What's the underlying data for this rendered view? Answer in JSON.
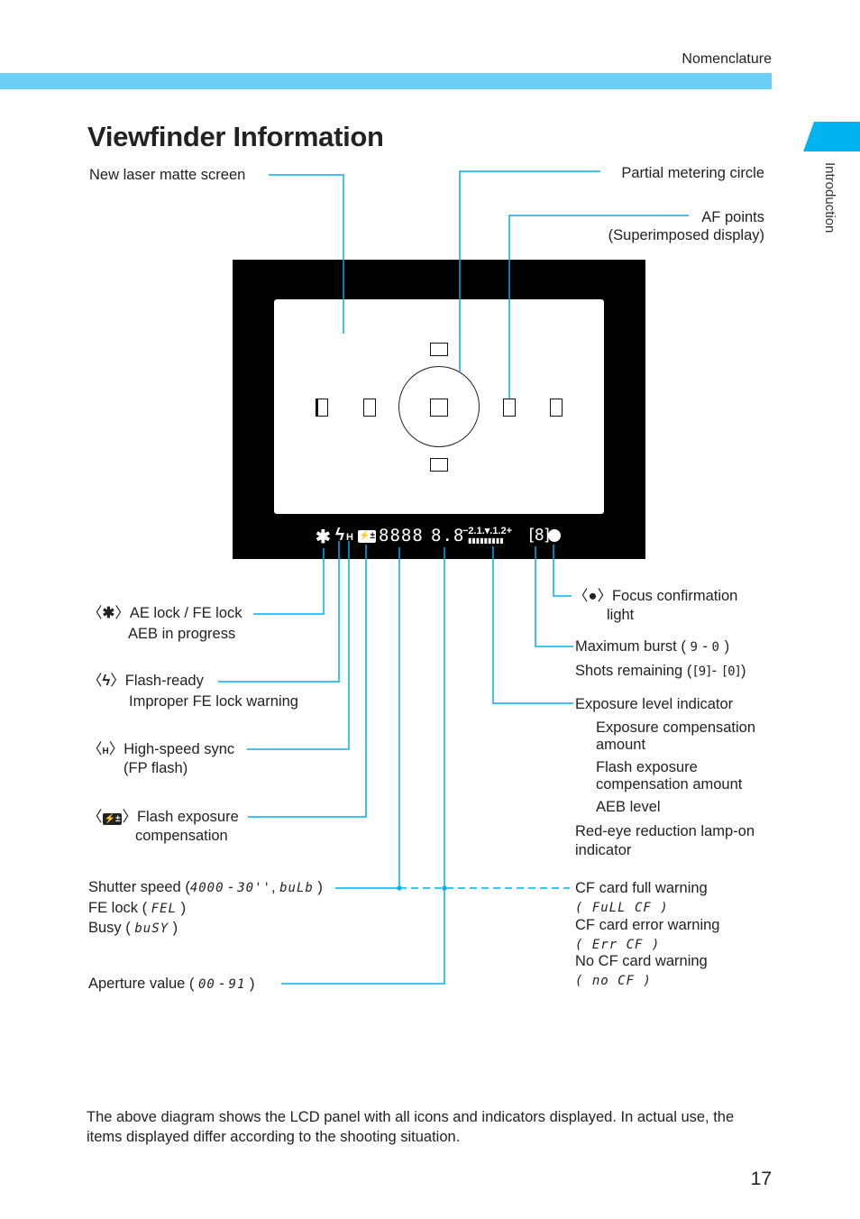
{
  "header": {
    "section": "Nomenclature",
    "side_tab": "Introduction",
    "title": "Viewfinder Information",
    "accent_color": "#00aeef",
    "band_color": "#6dcff5"
  },
  "top_callouts": {
    "matte_screen": "New laser matte screen",
    "metering_circle": "Partial metering circle",
    "af_points_line1": "AF points",
    "af_points_line2": "(Superimposed display)"
  },
  "lcd": {
    "ae_lock_icon": "✱",
    "flash_icon": "ϟ",
    "hs_icon": "H",
    "fec_icon": "⚡±",
    "shutter": "8888",
    "aperture": "8.8",
    "scale": "−2.1.▾.1.2+",
    "bars": "▮▮▮▮▮▮▮▮▮",
    "burst": "[8]",
    "focus_dot": "●"
  },
  "left_callouts": {
    "ae_lock": {
      "icon": "✱",
      "label": "AE lock / FE lock",
      "sub": "AEB in progress"
    },
    "flash_ready": {
      "icon": "ϟ",
      "label": "Flash-ready",
      "sub": "Improper FE lock warning"
    },
    "high_speed": {
      "icon": "H",
      "label": "High-speed sync",
      "sub": "(FP flash)"
    },
    "fec": {
      "icon": "⚡±",
      "label": "Flash exposure",
      "sub": "compensation"
    },
    "shutter": {
      "label": "Shutter speed (",
      "range": "4000",
      "dash": " - ",
      "range2": "30''",
      "sep": ", ",
      "bulb": "buLb",
      "close": " )"
    },
    "fe_lock": {
      "label": "FE lock ( ",
      "code": "FEL",
      "close": " )"
    },
    "busy": {
      "label": "Busy ( ",
      "code": "buSY",
      "close": " )"
    },
    "aperture": {
      "label": "Aperture value ( ",
      "range": "00",
      "dash": " - ",
      "range2": "91",
      "close": " )"
    }
  },
  "right_callouts": {
    "focus": {
      "icon": "●",
      "label": "Focus confirmation",
      "sub": "light"
    },
    "max_burst": {
      "label": "Maximum burst ( ",
      "range": "9",
      "dash": " - ",
      "range2": "0",
      "close": " )"
    },
    "shots": {
      "label": "Shots remaining (",
      "range": "[9]",
      "dash": "- ",
      "range2": "[0]",
      "close": ")"
    },
    "exposure": {
      "label": "Exposure level indicator",
      "items": [
        "Exposure compensation",
        "amount",
        "Flash exposure",
        "compensation amount",
        "AEB level"
      ],
      "red_eye_1": "Red-eye reduction lamp-on",
      "red_eye_2": "indicator"
    },
    "cf_full": {
      "label": "CF card full warning",
      "code": "( FuLL  CF )"
    },
    "cf_err": {
      "label": "CF card error warning",
      "code": "( Err  CF )"
    },
    "cf_none": {
      "label": "No CF card warning",
      "code": "( no  CF )"
    }
  },
  "footnote": "The above diagram shows the LCD panel with all icons and indicators displayed. In actual use, the items displayed differ according to the shooting situation.",
  "page_number": "17"
}
